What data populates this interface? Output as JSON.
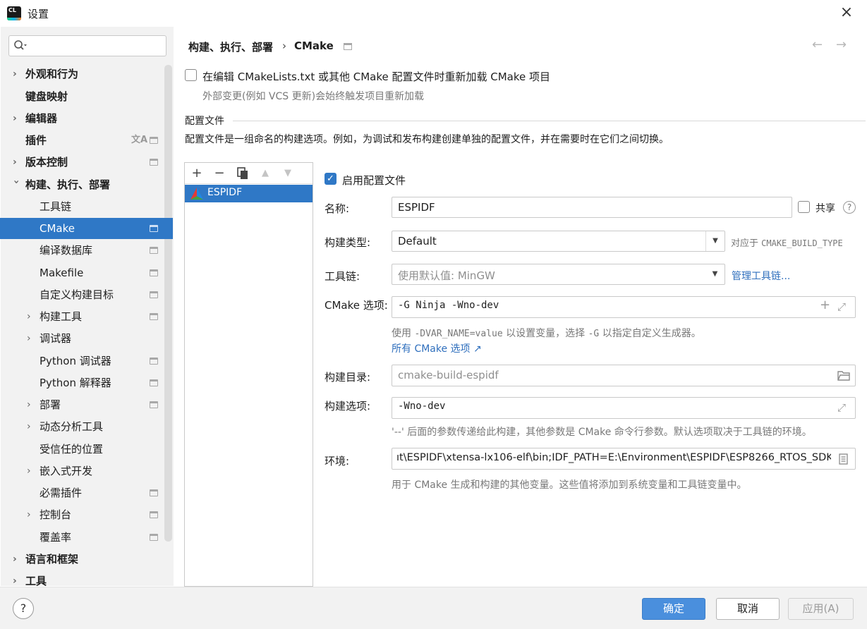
{
  "window": {
    "title": "设置",
    "app_icon_text": "CL"
  },
  "search": {
    "placeholder": ""
  },
  "sidebar": {
    "items": [
      {
        "label": "外观和行为"
      },
      {
        "label": "键盘映射"
      },
      {
        "label": "编辑器"
      },
      {
        "label": "插件"
      },
      {
        "label": "版本控制"
      },
      {
        "label": "构建、执行、部署"
      },
      {
        "label": "工具链"
      },
      {
        "label": "CMake"
      },
      {
        "label": "编译数据库"
      },
      {
        "label": "Makefile"
      },
      {
        "label": "自定义构建目标"
      },
      {
        "label": "构建工具"
      },
      {
        "label": "调试器"
      },
      {
        "label": "Python 调试器"
      },
      {
        "label": "Python 解释器"
      },
      {
        "label": "部署"
      },
      {
        "label": "动态分析工具"
      },
      {
        "label": "受信任的位置"
      },
      {
        "label": "嵌入式开发"
      },
      {
        "label": "必需插件"
      },
      {
        "label": "控制台"
      },
      {
        "label": "覆盖率"
      },
      {
        "label": "语言和框架"
      },
      {
        "label": "工具"
      }
    ]
  },
  "header": {
    "breadcrumb_parent": "构建、执行、部署",
    "separator": "›",
    "breadcrumb_current": "CMake"
  },
  "reload": {
    "label": "在编辑 CMakeLists.txt 或其他 CMake 配置文件时重新加载 CMake 项目",
    "hint": "外部变更(例如 VCS 更新)会始终触发项目重新加载",
    "checked": false
  },
  "profiles_section": {
    "title": "配置文件",
    "description": "配置文件是一组命名的构建选项。例如，为调试和发布构建创建单独的配置文件，并在需要时在它们之间切换。",
    "list": [
      "ESPIDF"
    ]
  },
  "form": {
    "enable_label": "启用配置文件",
    "enable_checked": true,
    "name_label": "名称:",
    "name_value": "ESPIDF",
    "share_label": "共享",
    "share_checked": false,
    "build_type_label": "构建类型:",
    "build_type_value": "Default",
    "build_type_hint_prefix": "对应于",
    "build_type_hint_code": "CMAKE_BUILD_TYPE",
    "toolchain_label": "工具链:",
    "toolchain_value": "使用默认值: MinGW",
    "toolchain_link": "管理工具链...",
    "cmake_options_label": "CMake 选项:",
    "cmake_options_value": "-G Ninja -Wno-dev",
    "cmake_hint_1": "使用",
    "cmake_hint_code1": "-DVAR_NAME=value",
    "cmake_hint_2": "以设置变量，选择",
    "cmake_hint_code2": "-G",
    "cmake_hint_3": "以指定自定义生成器。",
    "cmake_all_options_link": "所有 CMake 选项",
    "build_dir_label": "构建目录:",
    "build_dir_value": "cmake-build-espidf",
    "build_options_label": "构建选项:",
    "build_options_value": "-Wno-dev",
    "build_options_hint": "'--' 后面的参数传递给此构建，其他参数是 CMake 命令行参数。默认选项取决于工具链的环境。",
    "env_label": "环境:",
    "env_value": "ıt\\ESPIDF\\xtensa-lx106-elf\\bin;IDF_PATH=E:\\Environment\\ESPIDF\\ESP8266_RTOS_SDK",
    "env_hint": "用于 CMake 生成和构建的其他变量。这些值将添加到系统变量和工具链变量中。"
  },
  "buttons": {
    "ok": "确定",
    "cancel": "取消",
    "apply": "应用(A)",
    "help": "?"
  },
  "colors": {
    "accent": "#2f78c6",
    "link": "#2f6fbd",
    "ok_button": "#4a8fdd"
  }
}
